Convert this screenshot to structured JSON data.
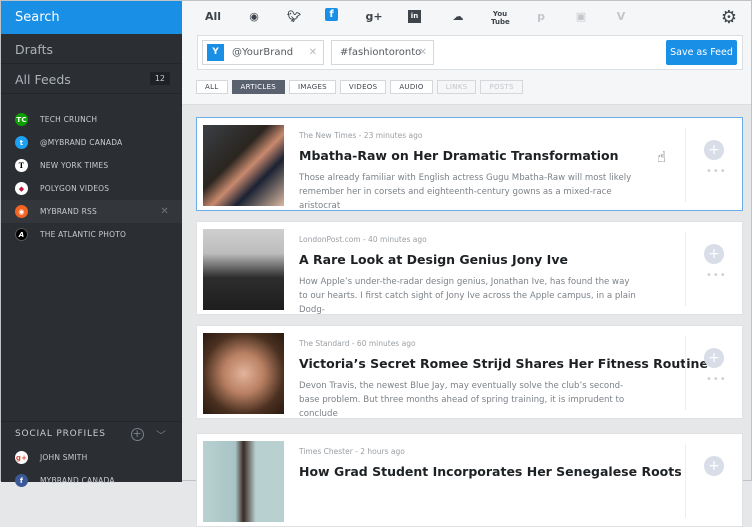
{
  "sidebar": {
    "search": "Search",
    "drafts": "Drafts",
    "all_feeds": "All Feeds",
    "all_feeds_count": "12",
    "feeds": [
      {
        "label": "TECH CRUNCH",
        "icon": "techcrunch-icon",
        "color": "#0a9e01",
        "glyph": "TC"
      },
      {
        "label": "@MYBRAND CANADA",
        "icon": "twitter-icon",
        "color": "#1da1f2",
        "glyph": "t"
      },
      {
        "label": "NEW YORK TIMES",
        "icon": "nyt-icon",
        "color": "#ffffff",
        "glyph": "T"
      },
      {
        "label": "POLYGON VIDEOS",
        "icon": "polygon-icon",
        "color": "#ffffff",
        "glyph": "◆"
      },
      {
        "label": "MYBRAND RSS",
        "icon": "rss-icon",
        "color": "#f26522",
        "glyph": "◉"
      },
      {
        "label": "THE ATLANTIC PHOTO",
        "icon": "atlantic-icon",
        "color": "#000000",
        "glyph": "A"
      }
    ],
    "social_title": "SOCIAL PROFILES",
    "profiles": [
      {
        "label": "JOHN SMITH"
      },
      {
        "label": "MYBRAND CANADA"
      }
    ]
  },
  "networks": [
    "All",
    "rss",
    "twitter",
    "facebook",
    "google-plus",
    "linkedin",
    "soundcloud",
    "youtube",
    "pinterest",
    "instagram",
    "vimeo"
  ],
  "network_all": "All",
  "search": {
    "tags": [
      "@YourBrand",
      "#fashiontoronto"
    ],
    "save_label": "Save as Feed"
  },
  "filters": [
    "ALL",
    "ARTICLES",
    "IMAGES",
    "VIDEOS",
    "AUDIO",
    "LINKS",
    "POSTS"
  ],
  "articles": [
    {
      "source": "The New Times - 23 minutes ago",
      "title": "Mbatha-Raw on Her Dramatic Transformation",
      "desc": "Those already familiar with English actress Gugu Mbatha-Raw will most likely remember her in corsets and eighteenth-century gowns as a mixed-race aristocrat"
    },
    {
      "source": "LondonPost.com - 40 minutes ago",
      "title": "A Rare Look at Design Genius Jony Ive",
      "desc": "How Apple’s under-the-radar design genius, Jonathan Ive, has found the way to our hearts. I first catch sight of Jony Ive across the Apple campus, in a plain Dodg-"
    },
    {
      "source": "The Standard - 60 minutes ago",
      "title": "Victoria’s Secret Romee Strijd Shares Her Fitness Routine",
      "desc": "Devon Travis, the newest Blue Jay, may eventually solve the club’s second-base problem. But three months ahead of spring training, it is imprudent to conclude"
    },
    {
      "source": "Times Chester - 2 hours ago",
      "title": "How Grad Student Incorporates Her Senegalese Roots",
      "desc": ""
    }
  ]
}
